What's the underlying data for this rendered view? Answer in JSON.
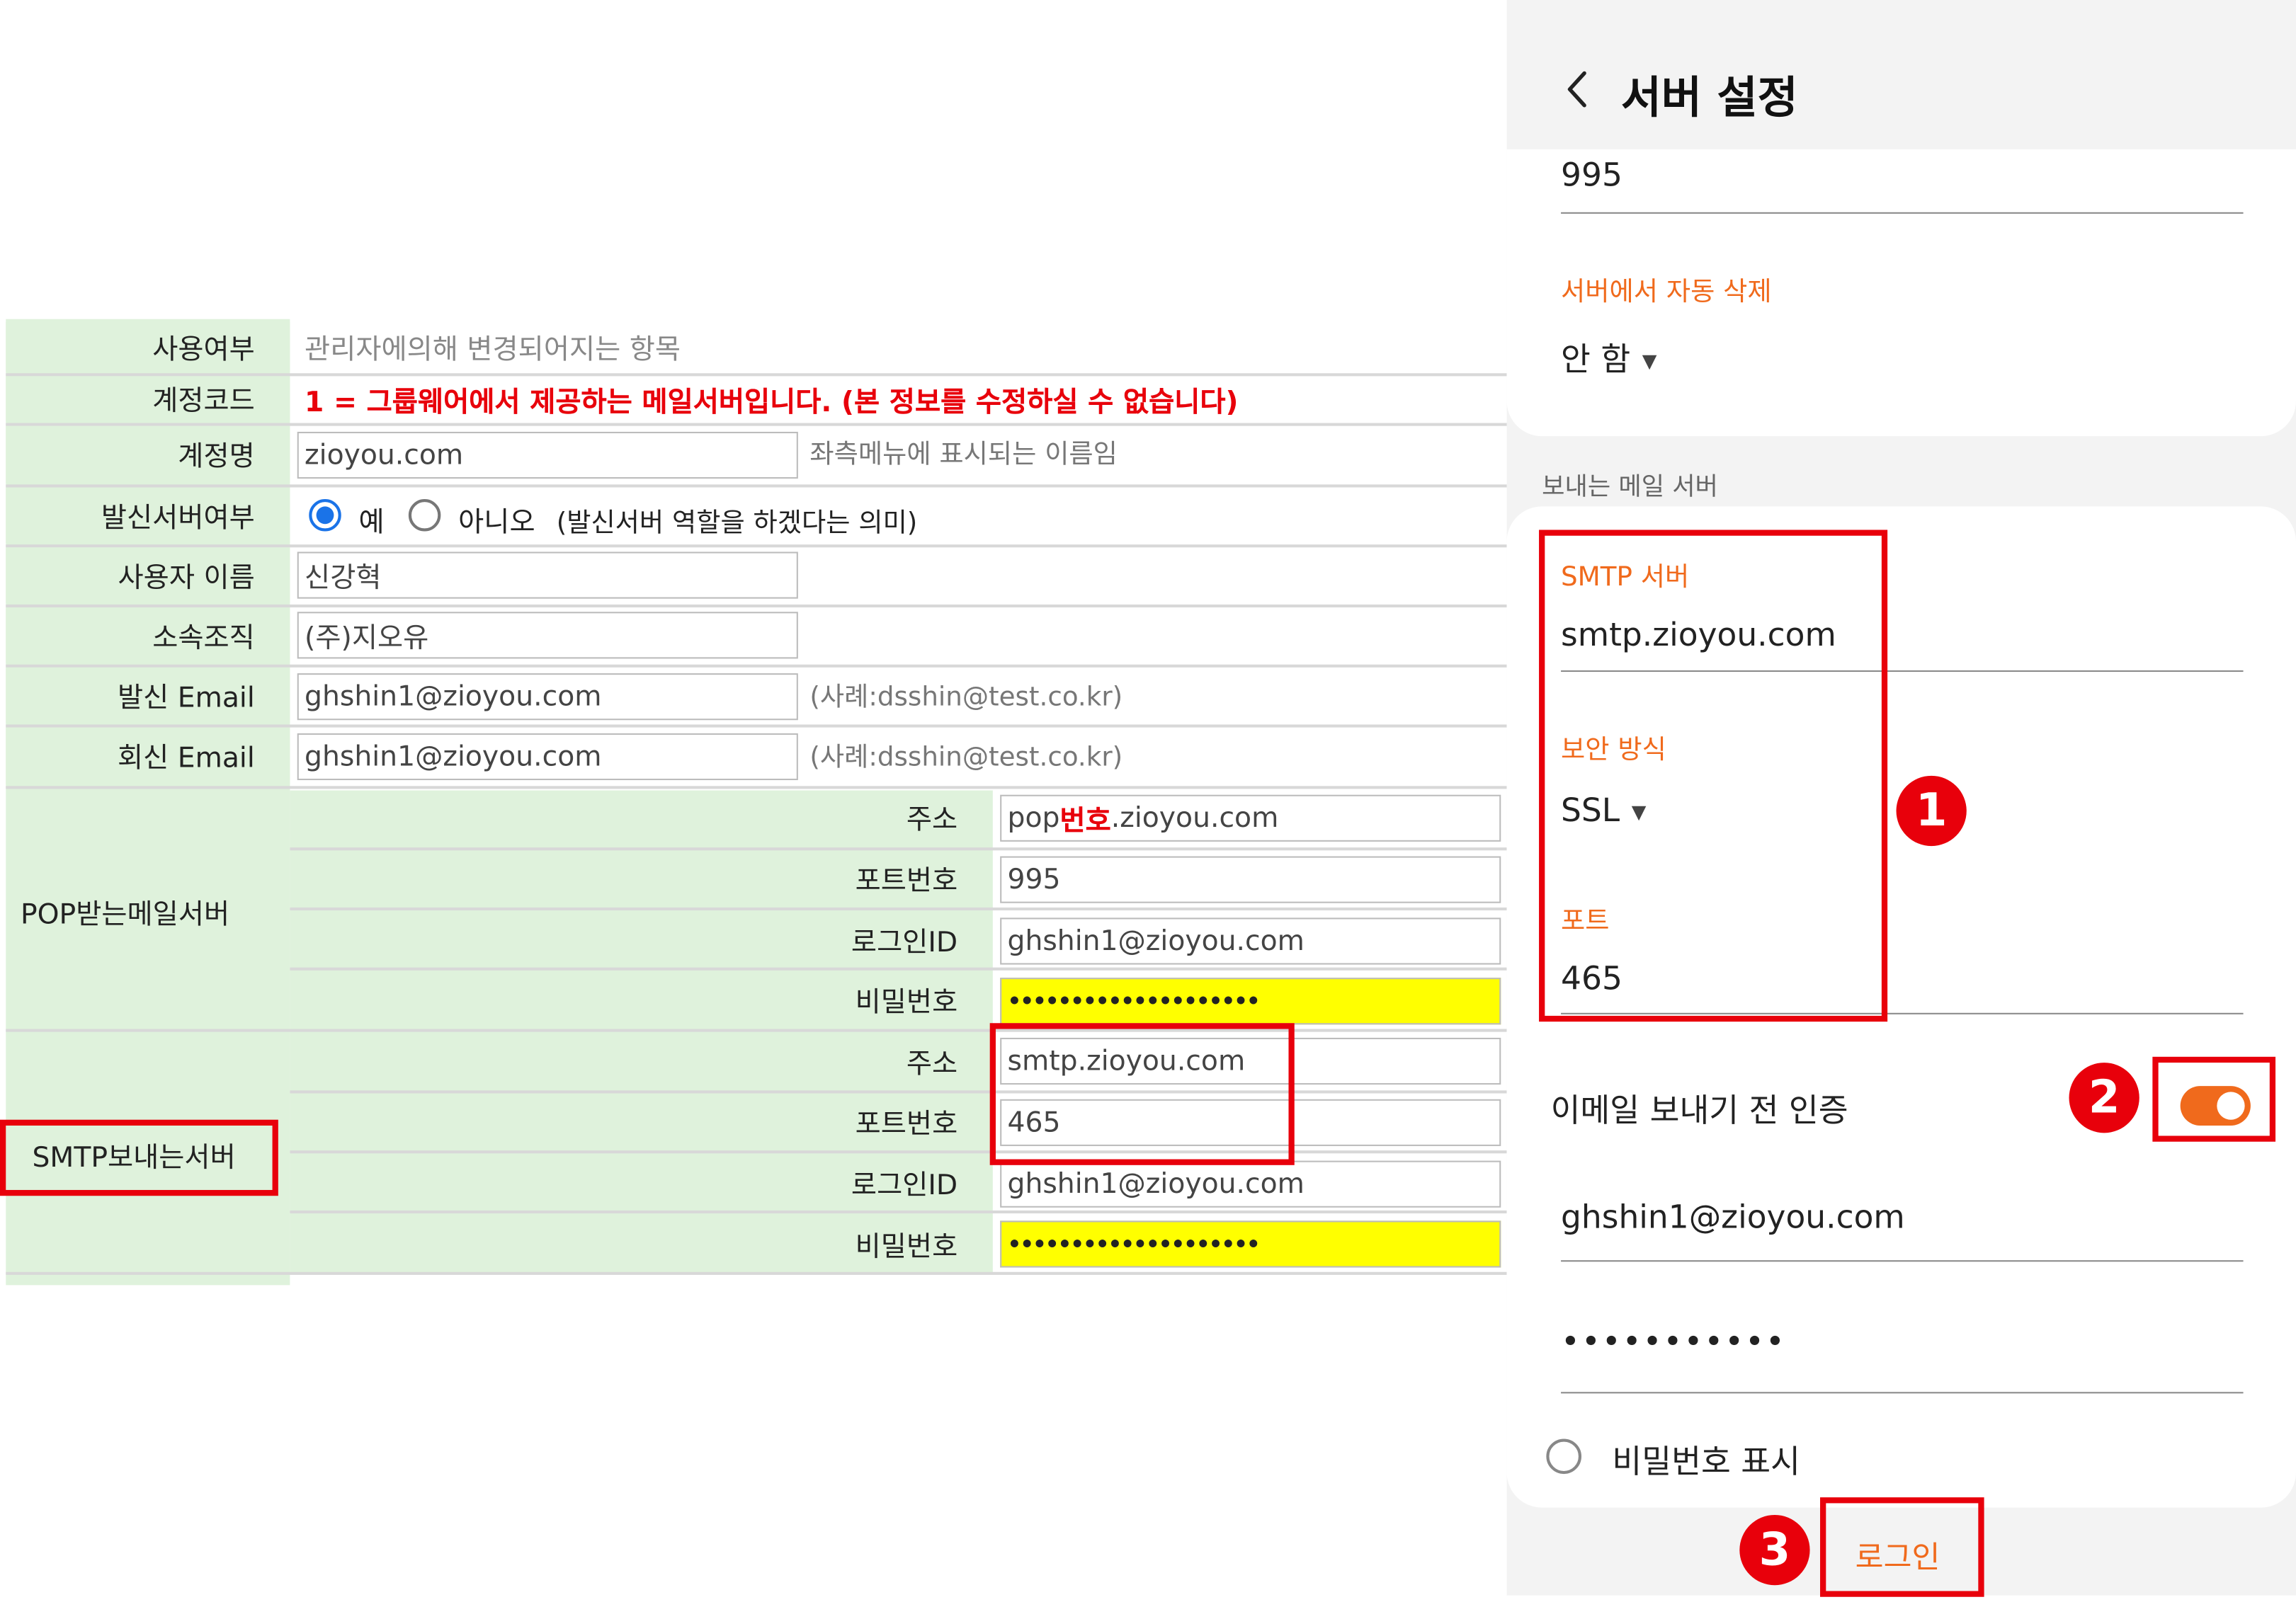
{
  "form": {
    "rows": {
      "usage": {
        "label": "사용여부",
        "value": "관리자에의해 변경되어지는 항목"
      },
      "account_code": {
        "label": "계정코드",
        "value": "1 = 그룹웨어에서 제공하는 메일서버입니다. (본 정보를 수정하실 수 없습니다)"
      },
      "account_name": {
        "label": "계정명",
        "value": "zioyou.com",
        "hint": "좌측메뉴에 표시되는 이름임"
      },
      "sending_server": {
        "label": "발신서버여부",
        "option_yes": "예",
        "option_no": "아니오",
        "note": "(발신서버 역할을 하겠다는 의미)",
        "selected": "예"
      },
      "user_name": {
        "label": "사용자 이름",
        "value": "신강혁"
      },
      "organization": {
        "label": "소속조직",
        "value": "(주)지오유"
      },
      "sender_email": {
        "label": "발신 Email",
        "value": "ghshin1@zioyou.com",
        "hint": "(사례:dsshin@test.co.kr)"
      },
      "reply_email": {
        "label": "회신 Email",
        "value": "ghshin1@zioyou.com",
        "hint": "(사례:dsshin@test.co.kr)"
      }
    },
    "pop": {
      "group_label": "POP받는메일서버",
      "address_label": "주소",
      "address_prefix": "pop",
      "address_mid": "번호",
      "address_suffix": ".zioyou.com",
      "port_label": "포트번호",
      "port": "995",
      "login_label": "로그인ID",
      "login": "ghshin1@zioyou.com",
      "password_label": "비밀번호",
      "password": "••••••••••••••••••••"
    },
    "smtp": {
      "group_label": "SMTP보내는서버",
      "address_label": "주소",
      "address": "smtp.zioyou.com",
      "port_label": "포트번호",
      "port": "465",
      "login_label": "로그인ID",
      "login": "ghshin1@zioyou.com",
      "password_label": "비밀번호",
      "password": "••••••••••••••••••••"
    }
  },
  "mobile": {
    "header_title": "서버 설정",
    "back_icon": "chevron-left-icon",
    "incoming_port": "995",
    "auto_delete_label": "서버에서 자동 삭제",
    "auto_delete_value": "안 함",
    "outgoing_section": "보내는 메일 서버",
    "smtp_server_label": "SMTP 서버",
    "smtp_server_value": "smtp.zioyou.com",
    "security_label": "보안 방식",
    "security_value": "SSL",
    "port_label": "포트",
    "port_value": "465",
    "auth_label": "이메일 보내기 전 인증",
    "auth_enabled": true,
    "username": "ghshin1@zioyou.com",
    "password": "•••••••••••",
    "show_password_label": "비밀번호 표시",
    "login_button": "로그인"
  },
  "annotations": {
    "step1": "1",
    "step2": "2",
    "step3": "3"
  },
  "colors": {
    "label_bg": "#dff2dc",
    "highlight_red": "#e8000b",
    "accent_orange": "#f06a1c",
    "password_bg": "#ffff00",
    "radio_blue": "#1a73e8"
  }
}
